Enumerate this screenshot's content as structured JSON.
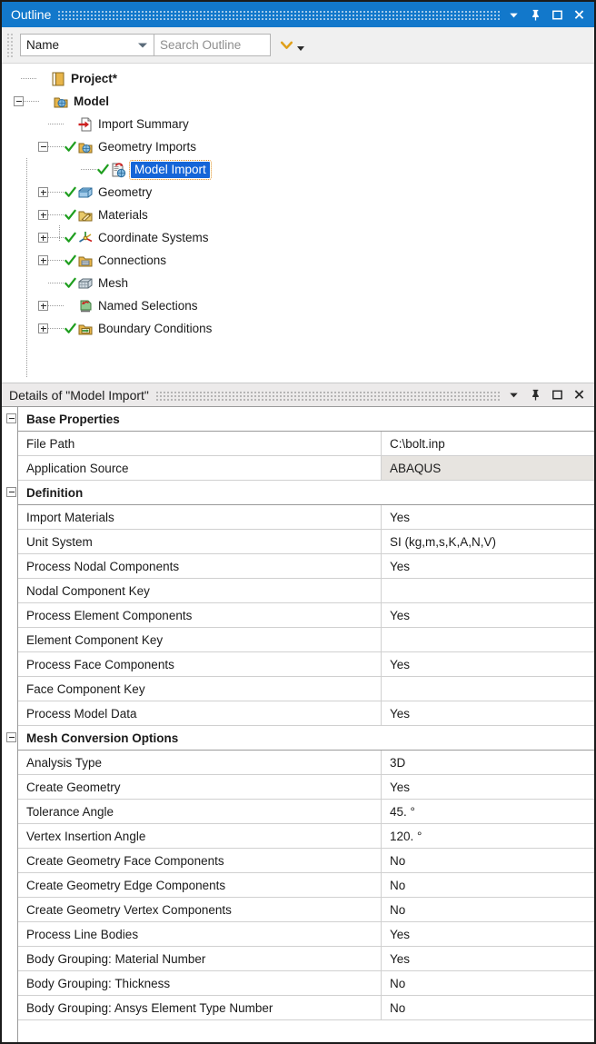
{
  "outline_panel": {
    "title": "Outline",
    "title_icons": [
      "chevron-down-icon",
      "pin-icon",
      "maximize-icon",
      "close-icon"
    ],
    "toolbar": {
      "filter_value": "Name",
      "search_placeholder": "Search Outline",
      "expand_icon": "chevron-down-yellow-icon"
    },
    "tree": [
      {
        "label": "Project*",
        "depth": 0,
        "bold": true,
        "icon": "project-icon",
        "expander": "none",
        "check": false,
        "selected": false
      },
      {
        "label": "Model",
        "depth": 1,
        "bold": true,
        "icon": "model-folder-icon",
        "expander": "minus",
        "check": false,
        "selected": false
      },
      {
        "label": "Import Summary",
        "depth": 2,
        "bold": false,
        "icon": "import-summary-icon",
        "expander": "none",
        "check": false,
        "selected": false
      },
      {
        "label": "Geometry Imports",
        "depth": 2,
        "bold": false,
        "icon": "geometry-imports-folder-icon",
        "expander": "minus",
        "check": true,
        "selected": false
      },
      {
        "label": "Model Import",
        "depth": 3,
        "bold": false,
        "icon": "model-import-icon",
        "expander": "none",
        "check": true,
        "selected": true
      },
      {
        "label": "Geometry",
        "depth": 2,
        "bold": false,
        "icon": "geometry-icon",
        "expander": "plus",
        "check": true,
        "selected": false
      },
      {
        "label": "Materials",
        "depth": 2,
        "bold": false,
        "icon": "materials-folder-icon",
        "expander": "plus",
        "check": true,
        "selected": false
      },
      {
        "label": "Coordinate Systems",
        "depth": 2,
        "bold": false,
        "icon": "coordinate-systems-icon",
        "expander": "plus",
        "check": true,
        "selected": false
      },
      {
        "label": "Connections",
        "depth": 2,
        "bold": false,
        "icon": "connections-folder-icon",
        "expander": "plus",
        "check": true,
        "selected": false
      },
      {
        "label": "Mesh",
        "depth": 2,
        "bold": false,
        "icon": "mesh-icon",
        "expander": "none",
        "check": true,
        "selected": false
      },
      {
        "label": "Named Selections",
        "depth": 2,
        "bold": false,
        "icon": "named-selections-icon",
        "expander": "plus",
        "check": false,
        "selected": false
      },
      {
        "label": "Boundary Conditions",
        "depth": 2,
        "bold": false,
        "icon": "boundary-conditions-folder-icon",
        "expander": "plus",
        "check": true,
        "selected": false
      }
    ]
  },
  "details_panel": {
    "title": "Details of \"Model Import\"",
    "title_icons": [
      "chevron-down-icon",
      "pin-icon",
      "maximize-icon",
      "close-icon"
    ],
    "rows": [
      {
        "type": "section",
        "name": "Base Properties",
        "value": ""
      },
      {
        "type": "row",
        "name": "File Path",
        "value": "C:\\bolt.inp",
        "readonly": false
      },
      {
        "type": "row",
        "name": "Application Source",
        "value": "ABAQUS",
        "readonly": true
      },
      {
        "type": "section",
        "name": "Definition",
        "value": ""
      },
      {
        "type": "row",
        "name": "Import Materials",
        "value": "Yes",
        "readonly": false
      },
      {
        "type": "row",
        "name": "Unit System",
        "value": "SI (kg,m,s,K,A,N,V)",
        "readonly": false
      },
      {
        "type": "row",
        "name": "Process Nodal Components",
        "value": "Yes",
        "readonly": false
      },
      {
        "type": "row",
        "name": "Nodal Component Key",
        "value": "",
        "readonly": false
      },
      {
        "type": "row",
        "name": "Process Element Components",
        "value": "Yes",
        "readonly": false
      },
      {
        "type": "row",
        "name": "Element Component Key",
        "value": "",
        "readonly": false
      },
      {
        "type": "row",
        "name": "Process Face Components",
        "value": "Yes",
        "readonly": false
      },
      {
        "type": "row",
        "name": "Face Component Key",
        "value": "",
        "readonly": false
      },
      {
        "type": "row",
        "name": "Process Model Data",
        "value": "Yes",
        "readonly": false
      },
      {
        "type": "section",
        "name": "Mesh Conversion Options",
        "value": ""
      },
      {
        "type": "row",
        "name": "Analysis Type",
        "value": "3D",
        "readonly": false
      },
      {
        "type": "row",
        "name": "Create Geometry",
        "value": "Yes",
        "readonly": false
      },
      {
        "type": "row",
        "name": "Tolerance Angle",
        "value": "45. °",
        "readonly": false
      },
      {
        "type": "row",
        "name": "Vertex Insertion Angle",
        "value": "120. °",
        "readonly": false
      },
      {
        "type": "row",
        "name": "Create Geometry Face Components",
        "value": "No",
        "readonly": false
      },
      {
        "type": "row",
        "name": "Create Geometry Edge Components",
        "value": "No",
        "readonly": false
      },
      {
        "type": "row",
        "name": "Create Geometry Vertex Components",
        "value": "No",
        "readonly": false
      },
      {
        "type": "row",
        "name": "Process Line Bodies",
        "value": "Yes",
        "readonly": false
      },
      {
        "type": "row",
        "name": "Body Grouping: Material Number",
        "value": "Yes",
        "readonly": false
      },
      {
        "type": "row",
        "name": "Body Grouping: Thickness",
        "value": "No",
        "readonly": false
      },
      {
        "type": "row",
        "name": "Body Grouping: Ansys Element Type Number",
        "value": "No",
        "readonly": false
      }
    ]
  },
  "colors": {
    "titlebar_blue": "#1278cb",
    "selection_blue": "#1565d8",
    "focus_orange": "#e08a1e",
    "check_green": "#1f9e1f",
    "readonly_gray": "#e7e4e0"
  }
}
